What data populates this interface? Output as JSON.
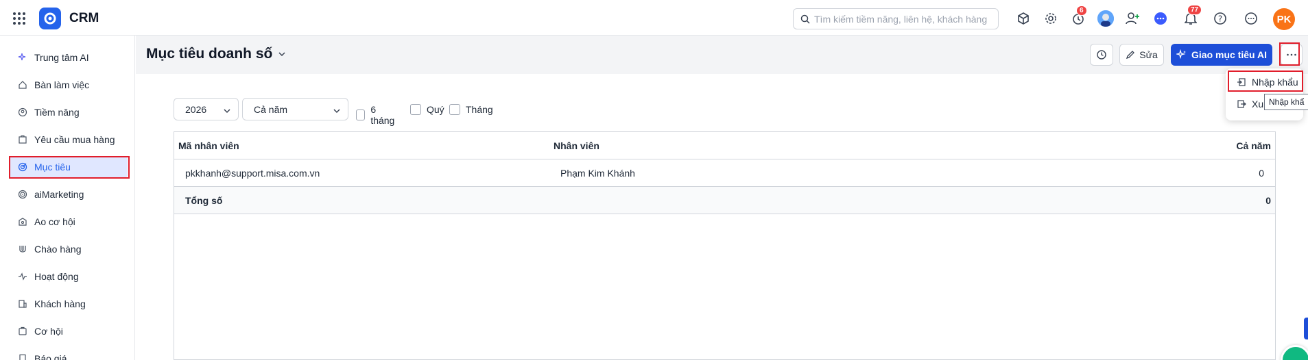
{
  "app": {
    "brand": "CRM"
  },
  "topbar": {
    "search_placeholder": "Tìm kiếm tiềm năng, liên hệ, khách hàng",
    "reminder_badge": "6",
    "notification_badge": "77",
    "user_initials": "PK"
  },
  "sidebar": {
    "items": [
      {
        "label": "Trung tâm AI",
        "icon": "sparkle-icon"
      },
      {
        "label": "Bàn làm việc",
        "icon": "home-icon"
      },
      {
        "label": "Tiềm năng",
        "icon": "lead-icon"
      },
      {
        "label": "Yêu cầu mua hàng",
        "icon": "order-icon"
      },
      {
        "label": "Mục tiêu",
        "icon": "target-icon",
        "active": true
      },
      {
        "label": "aiMarketing",
        "icon": "marketing-icon"
      },
      {
        "label": "Ao cơ hội",
        "icon": "pool-icon"
      },
      {
        "label": "Chào hàng",
        "icon": "magnet-icon"
      },
      {
        "label": "Hoạt động",
        "icon": "activity-icon"
      },
      {
        "label": "Khách hàng",
        "icon": "building-icon"
      },
      {
        "label": "Cơ hội",
        "icon": "opportunity-icon"
      },
      {
        "label": "Báo giá",
        "icon": "quote-icon"
      }
    ]
  },
  "page": {
    "title": "Mục tiêu doanh số",
    "edit_label": "Sửa",
    "assign_ai_label": "Giao mục tiêu AI"
  },
  "filters": {
    "year": "2026",
    "period": "Cả năm",
    "checkboxes": [
      "6 tháng",
      "Quý",
      "Tháng"
    ]
  },
  "table": {
    "headers": [
      "Mã nhân viên",
      "Nhân viên",
      "Cả năm"
    ],
    "rows": [
      {
        "code": "pkkhanh@support.misa.com.vn",
        "name": "Phạm Kim Khánh",
        "year_total": "0"
      }
    ],
    "total": {
      "label": "Tổng số",
      "value": "0"
    }
  },
  "menu": {
    "items": [
      "Nhập khẩu",
      "Xu"
    ],
    "tooltip": "Nhập khẩ"
  },
  "colors": {
    "primary": "#1d4ed8",
    "highlight": "#e11d2b",
    "active_bg": "#e0e7ff"
  }
}
